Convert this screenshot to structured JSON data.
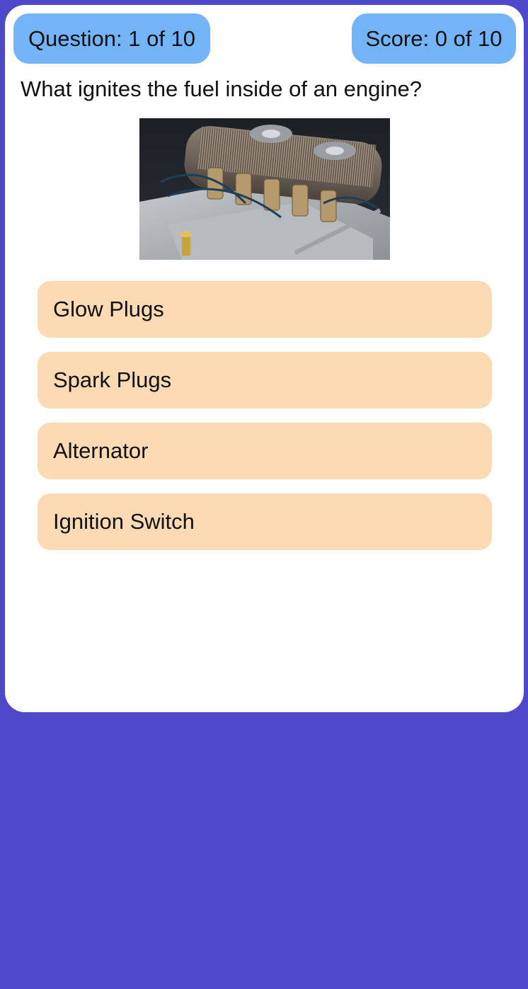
{
  "header": {
    "question_counter": "Question: 1 of 10",
    "score": "Score: 0 of 10"
  },
  "question": {
    "text": "What ignites the fuel inside of an engine?",
    "image_alt": "Car engine"
  },
  "answers": [
    {
      "label": "Glow Plugs"
    },
    {
      "label": "Spark Plugs"
    },
    {
      "label": "Alternator"
    },
    {
      "label": "Ignition Switch"
    }
  ],
  "colors": {
    "background": "#4e49cb",
    "card": "#ffffff",
    "pill": "#73b3f8",
    "answer": "#fcdab3"
  }
}
